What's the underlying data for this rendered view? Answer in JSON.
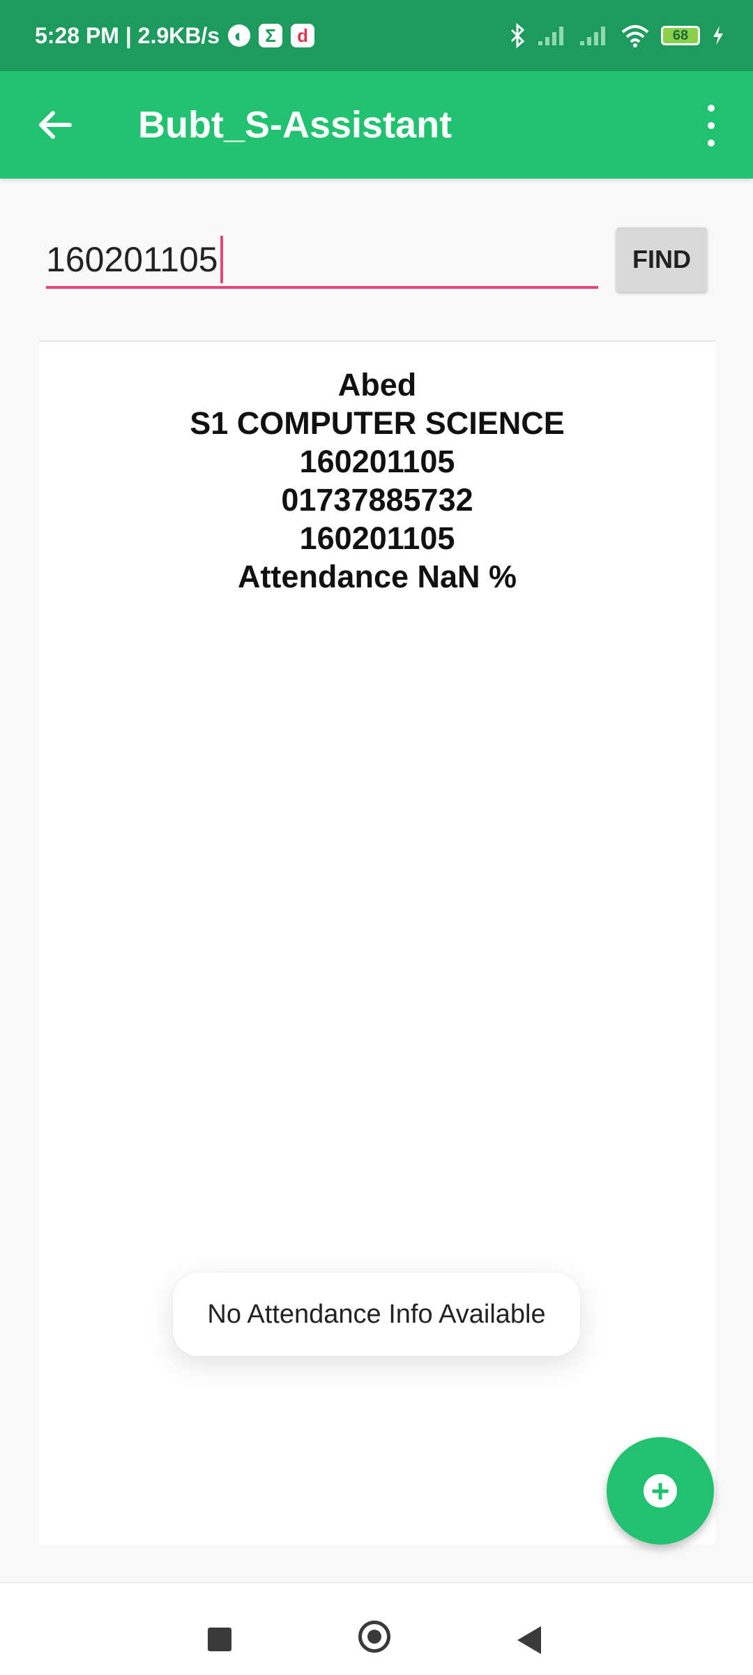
{
  "status_bar": {
    "time_speed": "5:28 PM | 2.9KB/s",
    "battery_level": "68",
    "icons": [
      "data-saver-icon",
      "sigma-app-icon",
      "d-app-icon",
      "bluetooth-icon",
      "signal-icon",
      "signal-icon",
      "wifi-icon",
      "battery-icon",
      "charging-icon"
    ]
  },
  "app_bar": {
    "title": "Bubt_S-Assistant",
    "color": "#20c270"
  },
  "search": {
    "value": "160201105",
    "button_label": "FIND"
  },
  "result": {
    "lines": [
      "Abed",
      "S1 COMPUTER SCIENCE",
      "160201105",
      "01737885732",
      "160201105",
      "Attendance NaN %"
    ]
  },
  "toast": {
    "message": "No Attendance Info Available"
  },
  "fab": {
    "icon": "add-icon"
  },
  "colors": {
    "status_bar": "#1c9b5c",
    "accent": "#e8437a"
  }
}
